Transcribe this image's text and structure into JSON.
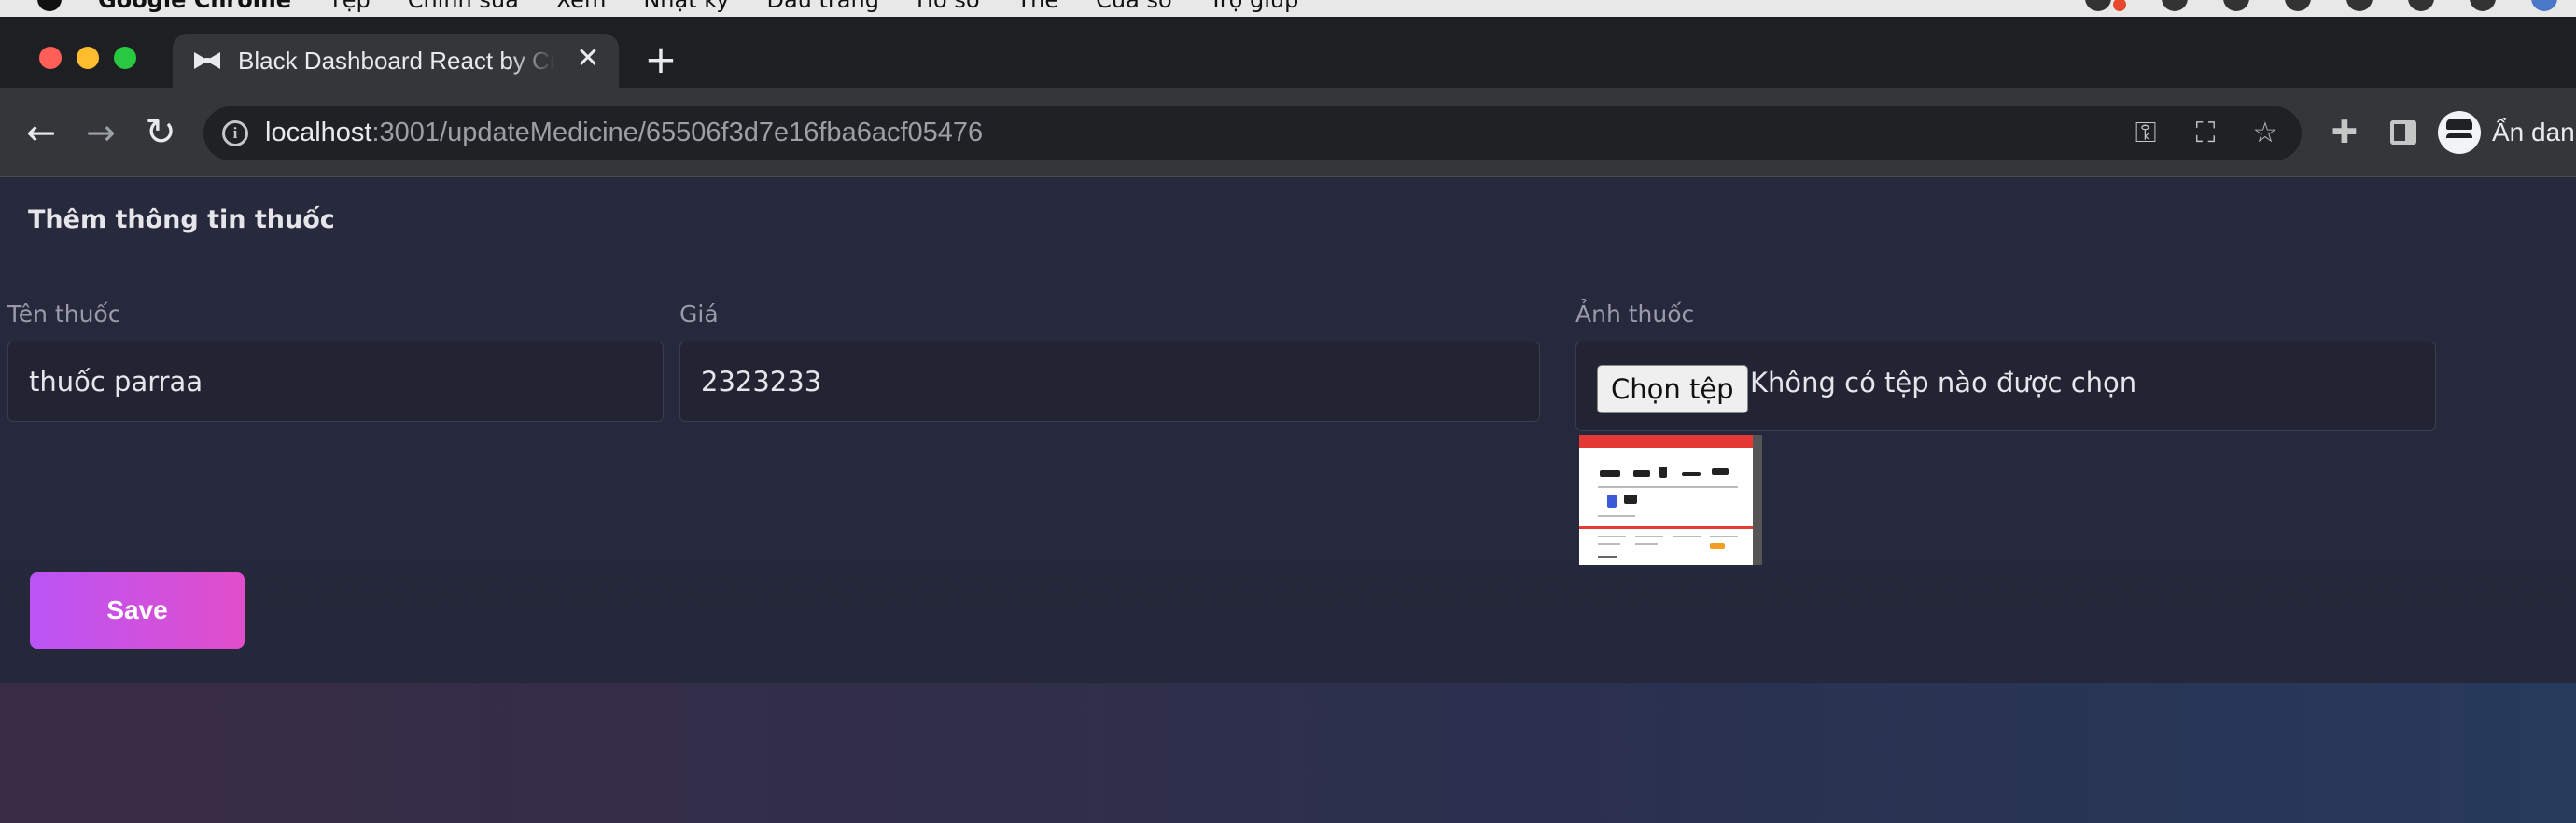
{
  "menubar": {
    "items": [
      "Google Chrome",
      "Tệp",
      "Chỉnh sửa",
      "Xem",
      "Nhật ký",
      "Dấu trang",
      "Hồ sơ",
      "Thẻ",
      "Cửa sổ",
      "Trợ giúp"
    ]
  },
  "browser": {
    "tab_title": "Black Dashboard React by Creative Tim",
    "url_host": "localhost",
    "url_path": ":3001/updateMedicine/65506f3d7e16fba6acf05476",
    "profile_name": "Ẩn danh"
  },
  "form": {
    "title": "Thêm thông tin thuốc",
    "name_label": "Tên thuốc",
    "name_value": "thuốc parraa",
    "price_label": "Giá",
    "price_value": "2323233",
    "image_label": "Ảnh thuốc",
    "file_button": "Chọn tệp",
    "file_status": "Không có tệp nào được chọn",
    "save_label": "Save"
  },
  "colors": {
    "accent_start": "#ba54f5",
    "accent_end": "#e14eca",
    "card_bg": "#27293d"
  }
}
